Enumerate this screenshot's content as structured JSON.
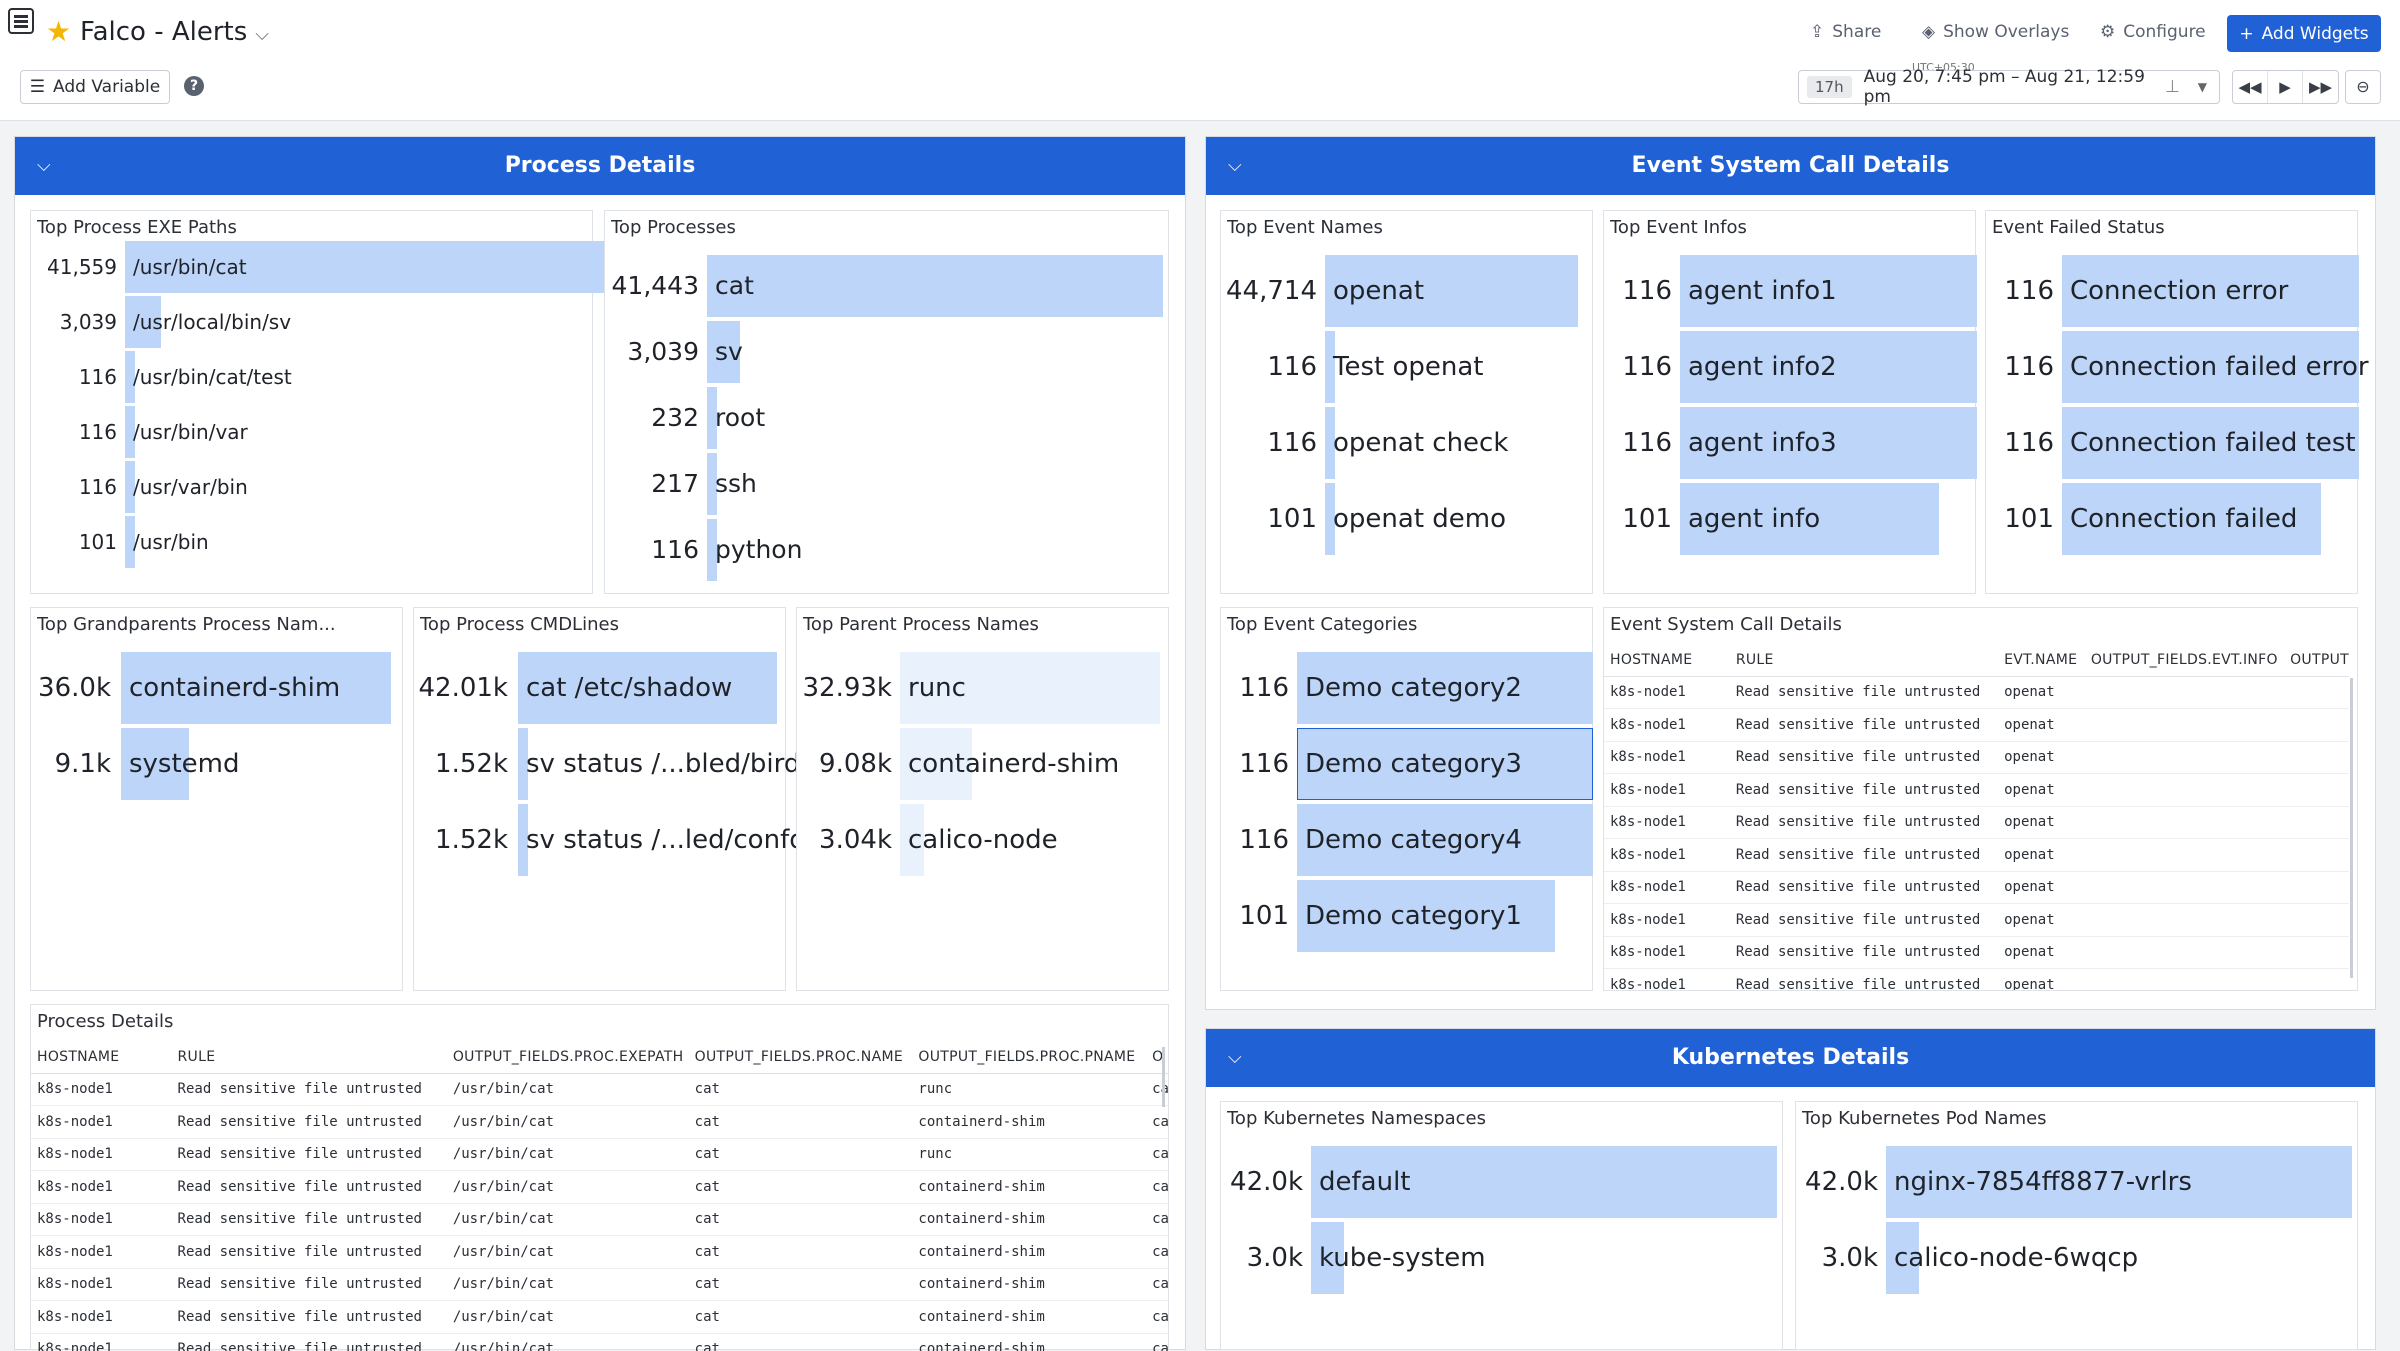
{
  "header": {
    "title": "Falco - Alerts",
    "share": "Share",
    "overlays": "Show Overlays",
    "configure": "Configure",
    "add_widgets": "Add Widgets",
    "add_variable": "Add Variable",
    "help": "?",
    "timezone": "UTC+05:30",
    "duration": "17h",
    "time_range": "Aug 20, 7:45 pm – Aug 21, 12:59 pm"
  },
  "groups": {
    "process": "Process Details",
    "event": "Event System Call Details",
    "kubernetes": "Kubernetes Details"
  },
  "widgets": {
    "exe_paths": {
      "title": "Top Process EXE Paths",
      "rows": [
        {
          "value": "41,559",
          "label": "/usr/bin/cat",
          "fraction": 1.0
        },
        {
          "value": "3,039",
          "label": "/usr/local/bin/sv",
          "fraction": 0.073
        },
        {
          "value": "116",
          "label": "/usr/bin/cat/test",
          "fraction": 0.003
        },
        {
          "value": "116",
          "label": "/usr/bin/var",
          "fraction": 0.003
        },
        {
          "value": "116",
          "label": "/usr/var/bin",
          "fraction": 0.003
        },
        {
          "value": "101",
          "label": "/usr/bin",
          "fraction": 0.002
        }
      ]
    },
    "processes": {
      "title": "Top Processes",
      "rows": [
        {
          "value": "41,443",
          "label": "cat",
          "fraction": 1.0
        },
        {
          "value": "3,039",
          "label": "sv",
          "fraction": 0.073
        },
        {
          "value": "232",
          "label": "root",
          "fraction": 0.006
        },
        {
          "value": "217",
          "label": "ssh",
          "fraction": 0.005
        },
        {
          "value": "116",
          "label": "python",
          "fraction": 0.003
        }
      ]
    },
    "grandparents": {
      "title": "Top Grandparents Process Nam...",
      "rows": [
        {
          "value": "36.0k",
          "label": "containerd-shim",
          "fraction": 1.0
        },
        {
          "value": "9.1k",
          "label": "systemd",
          "fraction": 0.253
        }
      ]
    },
    "cmdlines": {
      "title": "Top Process CMDLines",
      "rows": [
        {
          "value": "42.01k",
          "label": "cat /etc/shadow",
          "fraction": 1.0
        },
        {
          "value": "1.52k",
          "label": "sv status /...bled/bird",
          "fraction": 0.036
        },
        {
          "value": "1.52k",
          "label": "sv status /...led/confd",
          "fraction": 0.036
        }
      ]
    },
    "parents": {
      "title": "Top Parent Process Names",
      "rows": [
        {
          "value": "32.93k",
          "label": "runc",
          "fraction": 1.0
        },
        {
          "value": "9.08k",
          "label": "containerd-shim",
          "fraction": 0.276
        },
        {
          "value": "3.04k",
          "label": "calico-node",
          "fraction": 0.092
        }
      ]
    },
    "event_names": {
      "title": "Top Event Names",
      "rows": [
        {
          "value": "44,714",
          "label": "openat",
          "fraction": 1.0
        },
        {
          "value": "116",
          "label": "Test openat",
          "fraction": 0.003
        },
        {
          "value": "116",
          "label": "openat check",
          "fraction": 0.003
        },
        {
          "value": "101",
          "label": "openat demo",
          "fraction": 0.002
        }
      ]
    },
    "event_infos": {
      "title": "Top Event Infos",
      "rows": [
        {
          "value": "116",
          "label": "agent info1",
          "fraction": 1.0
        },
        {
          "value": "116",
          "label": "agent info2",
          "fraction": 1.0
        },
        {
          "value": "116",
          "label": "agent info3",
          "fraction": 1.0
        },
        {
          "value": "101",
          "label": "agent info",
          "fraction": 0.871
        }
      ]
    },
    "failed_status": {
      "title": "Event Failed Status",
      "rows": [
        {
          "value": "116",
          "label": "Connection error",
          "fraction": 1.0
        },
        {
          "value": "116",
          "label": "Connection failed error",
          "fraction": 1.0
        },
        {
          "value": "116",
          "label": "Connection failed test",
          "fraction": 1.0
        },
        {
          "value": "101",
          "label": "Connection failed",
          "fraction": 0.871
        }
      ]
    },
    "event_categories": {
      "title": "Top Event Categories",
      "rows": [
        {
          "value": "116",
          "label": "Demo category2",
          "fraction": 1.0
        },
        {
          "value": "116",
          "label": "Demo category3",
          "fraction": 1.0
        },
        {
          "value": "116",
          "label": "Demo category4",
          "fraction": 1.0
        },
        {
          "value": "101",
          "label": "Demo category1",
          "fraction": 0.871
        }
      ]
    },
    "namespaces": {
      "title": "Top Kubernetes Namespaces",
      "rows": [
        {
          "value": "42.0k",
          "label": "default",
          "fraction": 1.0
        },
        {
          "value": "3.0k",
          "label": "kube-system",
          "fraction": 0.071
        }
      ]
    },
    "pod_names": {
      "title": "Top Kubernetes Pod Names",
      "rows": [
        {
          "value": "42.0k",
          "label": "nginx-7854ff8877-vrlrs",
          "fraction": 1.0
        },
        {
          "value": "3.0k",
          "label": "calico-node-6wqcp",
          "fraction": 0.071
        }
      ]
    }
  },
  "event_table": {
    "title": "Event System Call Details",
    "columns": [
      "HOSTNAME",
      "RULE",
      "EVT.NAME",
      "OUTPUT_FIELDS.EVT.INFO",
      "OUTPUT"
    ],
    "rows": [
      [
        "k8s-node1",
        "Read sensitive file untrusted",
        "openat",
        "",
        ""
      ],
      [
        "k8s-node1",
        "Read sensitive file untrusted",
        "openat",
        "",
        ""
      ],
      [
        "k8s-node1",
        "Read sensitive file untrusted",
        "openat",
        "",
        ""
      ],
      [
        "k8s-node1",
        "Read sensitive file untrusted",
        "openat",
        "",
        ""
      ],
      [
        "k8s-node1",
        "Read sensitive file untrusted",
        "openat",
        "",
        ""
      ],
      [
        "k8s-node1",
        "Read sensitive file untrusted",
        "openat",
        "",
        ""
      ],
      [
        "k8s-node1",
        "Read sensitive file untrusted",
        "openat",
        "",
        ""
      ],
      [
        "k8s-node1",
        "Read sensitive file untrusted",
        "openat",
        "",
        ""
      ],
      [
        "k8s-node1",
        "Read sensitive file untrusted",
        "openat",
        "",
        ""
      ],
      [
        "k8s-node1",
        "Read sensitive file untrusted",
        "openat",
        "",
        ""
      ]
    ]
  },
  "process_table": {
    "title": "Process Details",
    "columns": [
      "HOSTNAME",
      "RULE",
      "OUTPUT_FIELDS.PROC.EXEPATH",
      "OUTPUT_FIELDS.PROC.NAME",
      "OUTPUT_FIELDS.PROC.PNAME",
      "O"
    ],
    "rows": [
      [
        "k8s-node1",
        "Read sensitive file untrusted",
        "/usr/bin/cat",
        "cat",
        "runc",
        "ca"
      ],
      [
        "k8s-node1",
        "Read sensitive file untrusted",
        "/usr/bin/cat",
        "cat",
        "containerd-shim",
        "ca"
      ],
      [
        "k8s-node1",
        "Read sensitive file untrusted",
        "/usr/bin/cat",
        "cat",
        "runc",
        "ca"
      ],
      [
        "k8s-node1",
        "Read sensitive file untrusted",
        "/usr/bin/cat",
        "cat",
        "containerd-shim",
        "ca"
      ],
      [
        "k8s-node1",
        "Read sensitive file untrusted",
        "/usr/bin/cat",
        "cat",
        "containerd-shim",
        "ca"
      ],
      [
        "k8s-node1",
        "Read sensitive file untrusted",
        "/usr/bin/cat",
        "cat",
        "containerd-shim",
        "ca"
      ],
      [
        "k8s-node1",
        "Read sensitive file untrusted",
        "/usr/bin/cat",
        "cat",
        "containerd-shim",
        "ca"
      ],
      [
        "k8s-node1",
        "Read sensitive file untrusted",
        "/usr/bin/cat",
        "cat",
        "containerd-shim",
        "ca"
      ],
      [
        "k8s-node1",
        "Read sensitive file untrusted",
        "/usr/bin/cat",
        "cat",
        "containerd-shim",
        "ca"
      ]
    ]
  }
}
